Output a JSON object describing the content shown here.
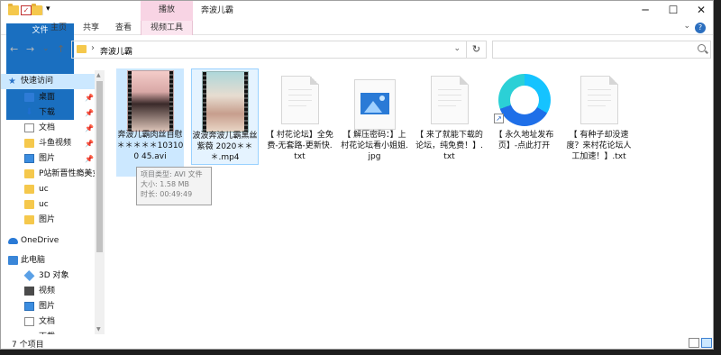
{
  "window": {
    "title": "奔波儿霸",
    "context_tab_header": "播放",
    "controls": {
      "minimize": "─",
      "maximize": "☐",
      "close": "✕"
    }
  },
  "quick_access": {
    "dropdown": "▾"
  },
  "ribbon": {
    "tabs": [
      "文件",
      "主页",
      "共享",
      "查看",
      "视频工具"
    ],
    "collapse": "⌄",
    "help": "?"
  },
  "nav": {
    "back": "←",
    "forward": "→",
    "recent": "⌄",
    "up": "↑"
  },
  "address": {
    "separator": "›",
    "path": "奔波儿霸",
    "dropdown": "⌄"
  },
  "refresh": "↻",
  "search": {
    "placeholder": ""
  },
  "sidebar": {
    "quick_access_label": "快速访问",
    "pinned": [
      "桌面",
      "下载",
      "文档",
      "斗鱼视频",
      "图片"
    ],
    "folders": [
      "P站新晋性瘾美女",
      "uc",
      "uc",
      "图片"
    ],
    "onedrive_label": "OneDrive",
    "this_pc_label": "此电脑",
    "pc_items": [
      "3D 对象",
      "视频",
      "图片",
      "文档",
      "下载"
    ],
    "pin_glyph": "📌"
  },
  "files": [
    {
      "name": "奔波儿霸肉丝自慰＊＊＊＊＊103100 45.avi",
      "type": "video"
    },
    {
      "name": "波波奔波儿霸黑丝紫薇 2020＊＊＊.mp4",
      "type": "video"
    },
    {
      "name": "【 村花论坛】全免费-无套路-更新快.txt",
      "type": "txt"
    },
    {
      "name": "【 解压密码：】上村花论坛看小姐姐.jpg",
      "type": "jpg"
    },
    {
      "name": "【 来了就能下载的论坛，纯免费！】.txt",
      "type": "txt"
    },
    {
      "name": "【 永久地址发布页】-点此打开",
      "type": "shortcut"
    },
    {
      "name": "【 有种子却没速度？来村花论坛人工加速！】.txt",
      "type": "txt"
    }
  ],
  "tooltip": {
    "line1": "项目类型: AVI 文件",
    "line2": "大小: 1.58 MB",
    "line3": "时长: 00:49:49"
  },
  "status": {
    "items_text": "7 个项目"
  },
  "colors": {
    "accent": "#1a6fc0",
    "selection": "#cce8ff",
    "context_tab": "#f8d4e4"
  }
}
